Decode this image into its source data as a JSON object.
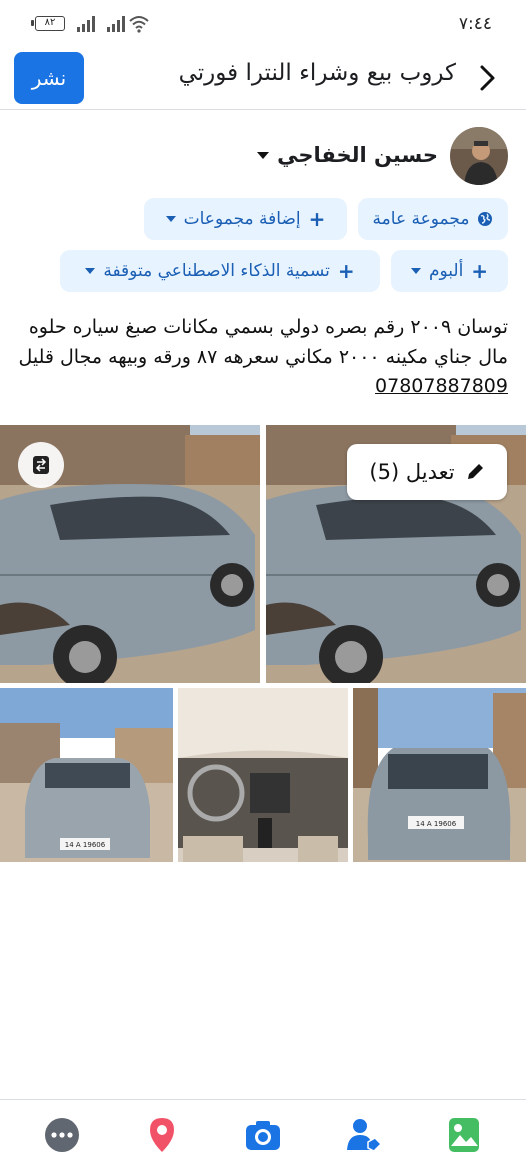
{
  "status_bar": {
    "time": "٧:٤٤",
    "battery": "٨٢"
  },
  "header": {
    "title": "كروب بيع وشراء النترا فورتي",
    "post_label": "نشر"
  },
  "author": {
    "name": "حسين الخفاجي"
  },
  "chips": {
    "public_group": "مجموعة عامة",
    "add_groups": "إضافة مجموعات",
    "album": "ألبوم",
    "ai_label": "تسمية الذكاء الاصطناعي متوقفة"
  },
  "post": {
    "text": "توسان ٢٠٠٩ رقم بصره دولي بسمي مكانات صبغ سياره حلوه مال جناي مكينه ٢٠٠٠ مكاني سعرهه ٨٧ ورقه وبيهه مجال قليل",
    "phone": "07807887809"
  },
  "photos": {
    "edit_label": "تعديل (5)",
    "plate_text": "14 A 19606"
  },
  "bottom_bar": {
    "items": [
      "more-icon",
      "location-icon",
      "camera-icon",
      "tag-people-icon",
      "photo-icon"
    ]
  },
  "colors": {
    "accent": "#1b74e4",
    "chip_bg": "#e7f3ff",
    "chip_text": "#1b5fb4"
  }
}
